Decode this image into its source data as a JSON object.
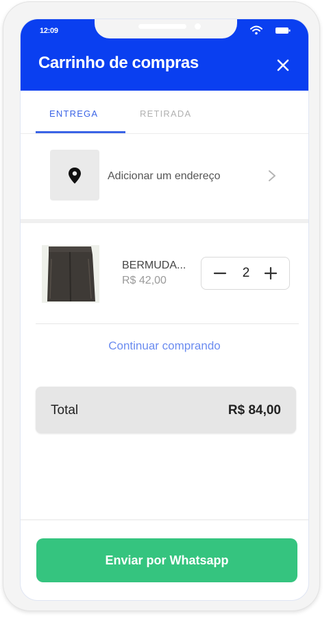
{
  "status_bar": {
    "time": "12:09",
    "wifi_icon": "wifi-icon",
    "battery_icon": "battery-icon"
  },
  "header": {
    "title": "Carrinho de compras",
    "close_icon": "close-icon",
    "background_color": "#0a3ff0"
  },
  "tabs": [
    {
      "label": "ENTREGA",
      "active": true
    },
    {
      "label": "RETIRADA",
      "active": false
    }
  ],
  "address": {
    "label": "Adicionar um endereço",
    "pin_icon": "map-pin-icon",
    "chevron_icon": "chevron-right-icon"
  },
  "cart": {
    "items": [
      {
        "name": "BERMUDA...",
        "price": "R$ 42,00",
        "quantity": "2"
      }
    ],
    "continue_label": "Continuar comprando"
  },
  "total": {
    "label": "Total",
    "value": "R$ 84,00"
  },
  "footer": {
    "button_label": "Enviar por Whatsapp",
    "button_color": "#35c47f"
  }
}
